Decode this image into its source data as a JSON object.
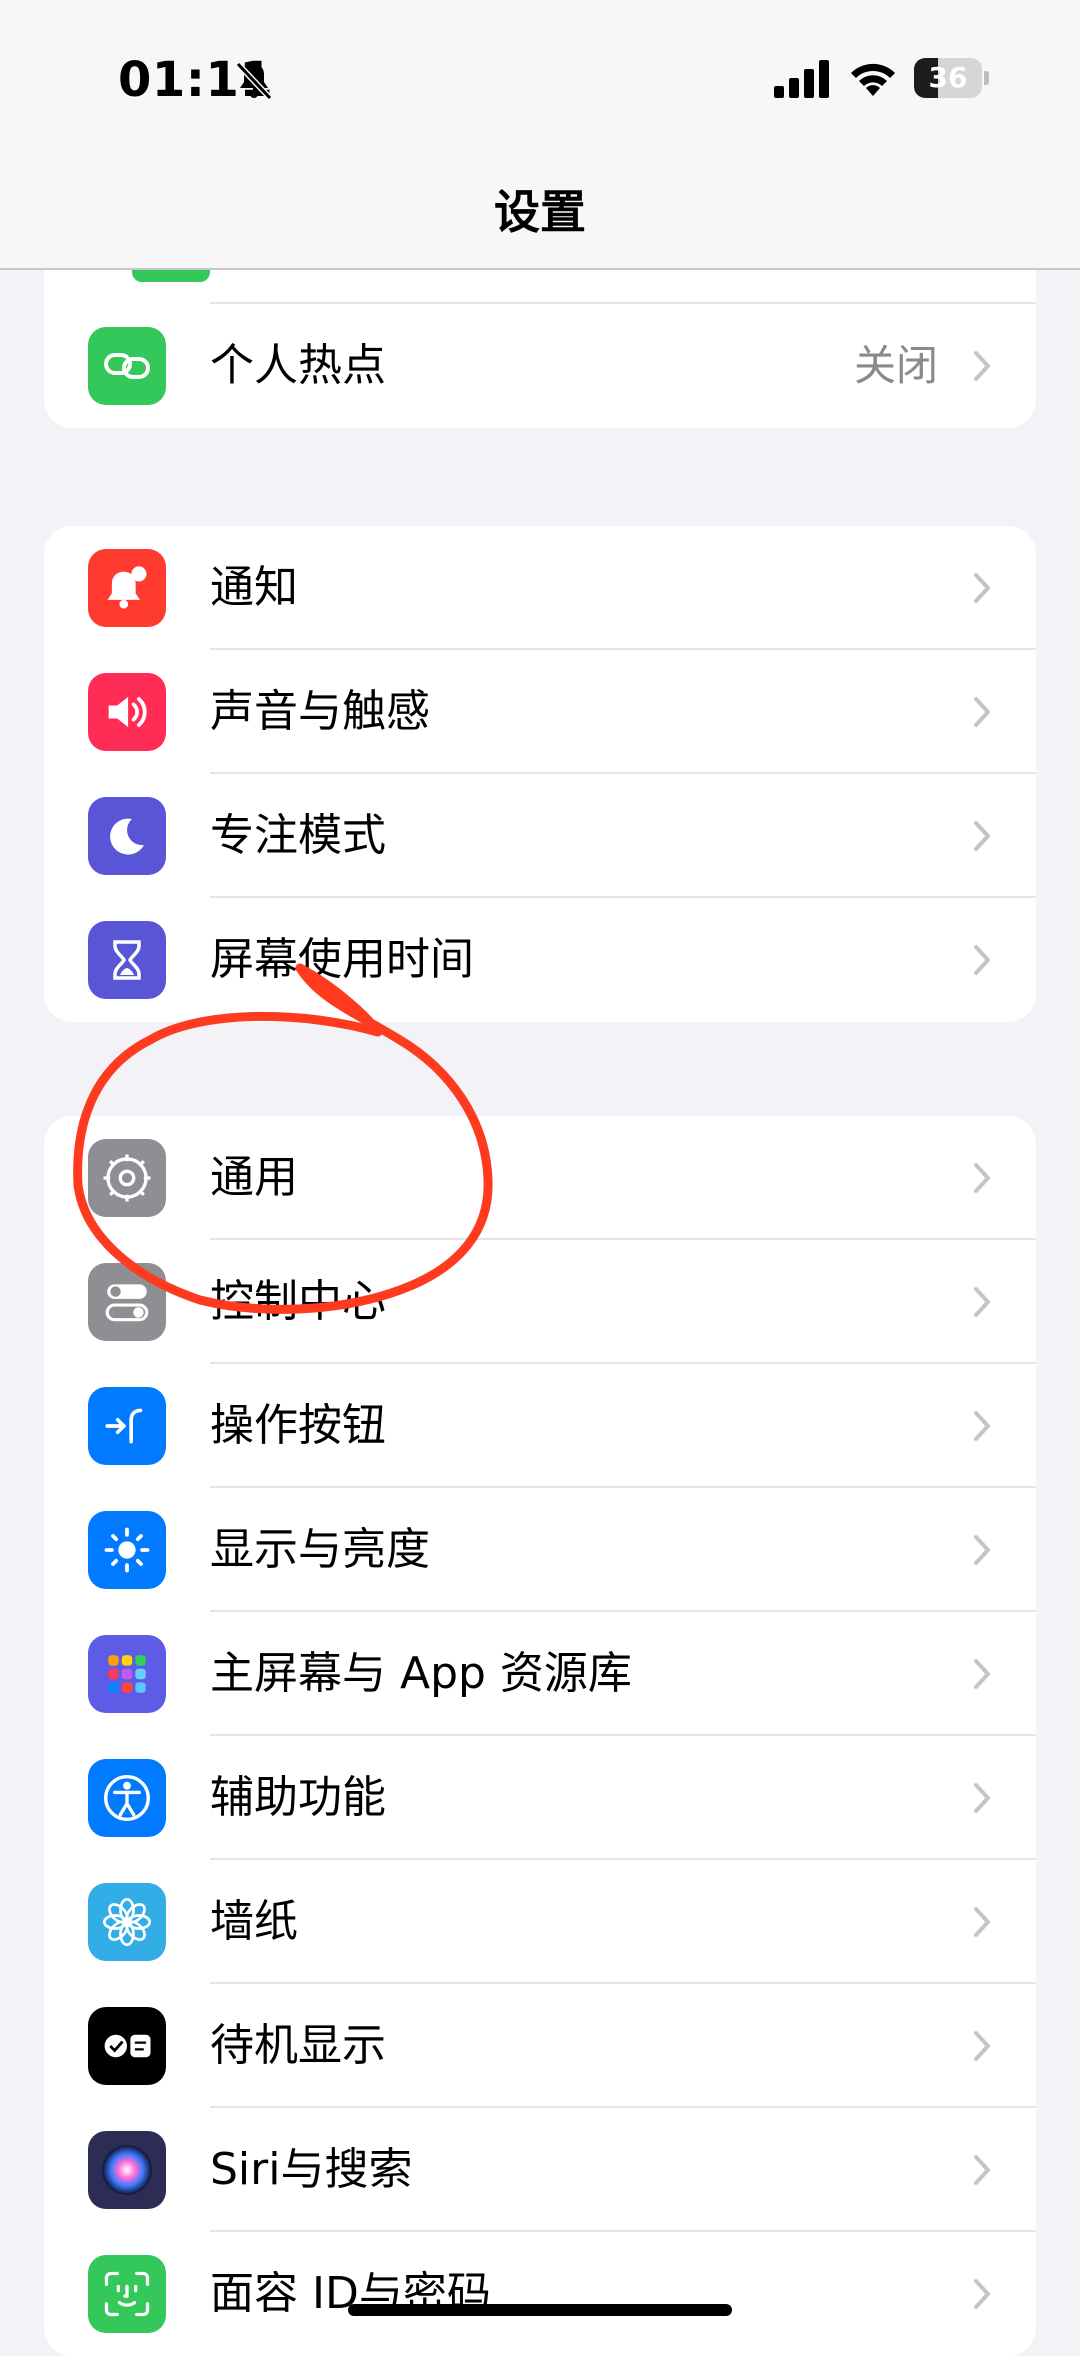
{
  "status_bar": {
    "time": "01:11",
    "battery": "36",
    "battery_level": 0.36
  },
  "nav": {
    "title": "设置"
  },
  "groups": [
    {
      "rows": [
        {
          "label": "个人热点",
          "value": "关闭",
          "icon": "hotspot-link-icon",
          "color": "#34c759"
        }
      ]
    },
    {
      "rows": [
        {
          "label": "通知",
          "icon": "bell-badge-icon",
          "color": "#ff3b30"
        },
        {
          "label": "声音与触感",
          "icon": "speaker-icon",
          "color": "#ff2d55"
        },
        {
          "label": "专注模式",
          "icon": "moon-icon",
          "color": "#5856d6"
        },
        {
          "label": "屏幕使用时间",
          "icon": "hourglass-icon",
          "color": "#5856d6"
        }
      ]
    },
    {
      "rows": [
        {
          "label": "通用",
          "icon": "gear-icon",
          "color": "#8e8e93"
        },
        {
          "label": "控制中心",
          "icon": "toggles-icon",
          "color": "#8e8e93"
        },
        {
          "label": "操作按钮",
          "icon": "action-button-icon",
          "color": "#007aff"
        },
        {
          "label": "显示与亮度",
          "icon": "sun-icon",
          "color": "#007aff"
        },
        {
          "label": "主屏幕与 App 资源库",
          "icon": "app-grid-icon",
          "color": "#5e5ce6"
        },
        {
          "label": "辅助功能",
          "icon": "accessibility-icon",
          "color": "#007aff"
        },
        {
          "label": "墙纸",
          "icon": "flower-icon",
          "color": "#32ade6"
        },
        {
          "label": "待机显示",
          "icon": "standby-icon",
          "color": "#000000"
        },
        {
          "label": "Siri与搜索",
          "icon": "siri-icon",
          "color": "#2c2c54"
        },
        {
          "label": "面容 ID与密码",
          "icon": "faceid-icon",
          "color": "#34c759"
        }
      ]
    }
  ],
  "annotation_color": "#ff3b1f"
}
